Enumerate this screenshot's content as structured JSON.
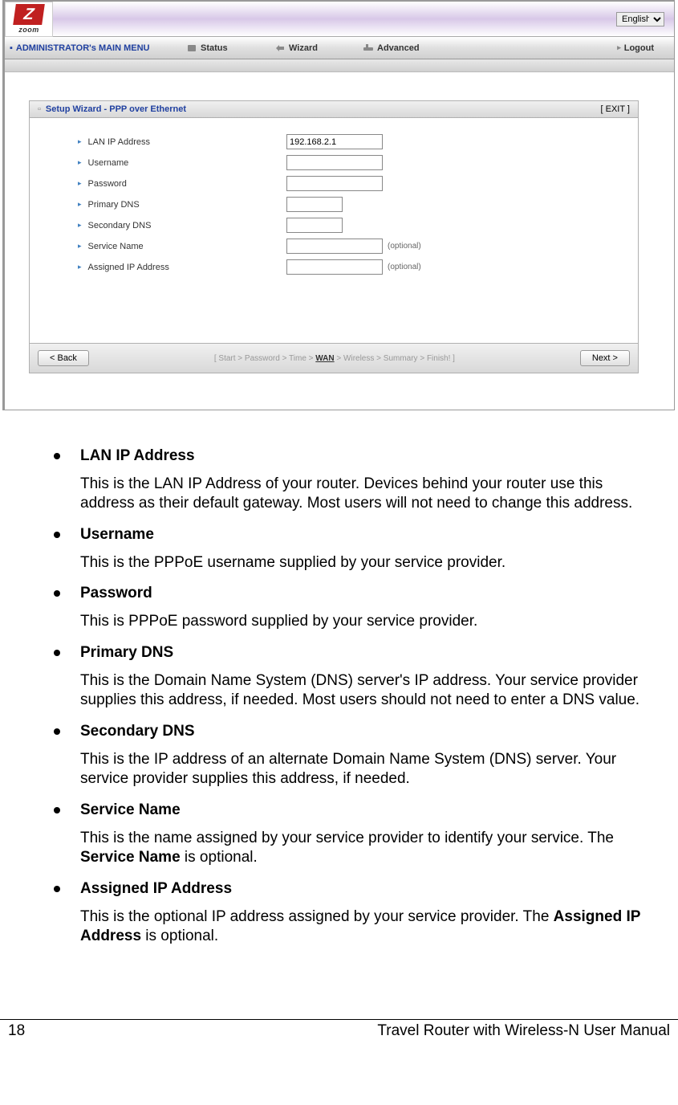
{
  "topbar": {
    "logo_letter": "Z",
    "logo_text": "zoom",
    "language": "English"
  },
  "menu": {
    "title": "ADMINISTRATOR's MAIN MENU",
    "status": "Status",
    "wizard": "Wizard",
    "advanced": "Advanced",
    "logout": "Logout"
  },
  "wizard": {
    "header_title": "Setup Wizard - PPP over Ethernet",
    "exit": "[ EXIT ]",
    "fields": {
      "lan_ip_label": "LAN IP Address",
      "lan_ip_value": "192.168.2.1",
      "username_label": "Username",
      "username_value": "",
      "password_label": "Password",
      "password_value": "",
      "primary_dns_label": "Primary DNS",
      "primary_dns_value": "",
      "secondary_dns_label": "Secondary DNS",
      "secondary_dns_value": "",
      "service_name_label": "Service Name",
      "service_name_value": "",
      "service_name_optional": "(optional)",
      "assigned_ip_label": "Assigned IP Address",
      "assigned_ip_value": "",
      "assigned_ip_optional": "(optional)"
    },
    "back_button": "< Back",
    "next_button": "Next >",
    "breadcrumb": {
      "prefix": "[ Start > Password > Time > ",
      "active": "WAN",
      "suffix": " > Wireless > Summary > Finish! ]"
    }
  },
  "doc": {
    "items": [
      {
        "title": "LAN IP Address",
        "desc": "This is the LAN IP Address of your router. Devices behind your router use this address as their default gateway. Most users will not need to change this address."
      },
      {
        "title": "Username",
        "desc": "This is the PPPoE username supplied by your service provider."
      },
      {
        "title": "Password",
        "desc": "This is PPPoE password supplied by your service provider."
      },
      {
        "title": "Primary DNS",
        "desc": "This is the Domain Name System (DNS) server's IP address. Your service provider supplies this address, if needed. Most users should not need to enter a DNS value."
      },
      {
        "title": "Secondary DNS",
        "desc": "This is the IP address of an alternate Domain Name System (DNS) server. Your service provider supplies this address, if needed."
      }
    ],
    "service_name_title": "Service Name",
    "service_name_desc_pre": "This is the name assigned by your service provider to identify your service. The ",
    "service_name_bold": "Service Name",
    "service_name_desc_post": " is optional.",
    "assigned_ip_title": "Assigned IP Address",
    "assigned_ip_desc_pre": "This is the optional IP address assigned by your service provider. The ",
    "assigned_ip_bold": "Assigned IP Address",
    "assigned_ip_desc_post": " is optional."
  },
  "footer": {
    "page": "18",
    "title": "Travel Router with Wireless-N User Manual"
  }
}
